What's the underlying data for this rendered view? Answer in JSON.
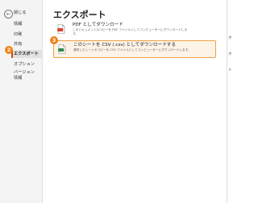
{
  "nav": {
    "back_icon_symbol": "←",
    "back_label": "閉じる",
    "items": [
      {
        "label": "情報"
      },
      {
        "label": "印刷"
      },
      {
        "label": "共有"
      },
      {
        "label": "エクスポート"
      },
      {
        "label": "オプション"
      },
      {
        "label": "バージョン情報"
      }
    ]
  },
  "badges": {
    "nav_step": "2",
    "option_step": "3"
  },
  "main": {
    "title": "エクスポート",
    "options": [
      {
        "title": "PDF としてダウンロード",
        "desc_line1": "このドキュメントのコピーを PDF ファイルとしてコンピューターにダウンロードしま",
        "desc_line2": "す。",
        "icon": "pdf-file-icon"
      },
      {
        "title": "このシートを CSV (.csv) としてダウンロードする",
        "desc_line1": "選択したシートのコピーを CSV ファイルとしてコンピューターにダウンロードします。",
        "icon": "csv-file-icon"
      }
    ]
  },
  "edge": {
    "chars": [
      "ホ",
      "ホ",
      "ド"
    ]
  },
  "colors": {
    "accent": "#d04a02",
    "badge": "#f0831a",
    "highlight_border": "#f0a040"
  }
}
